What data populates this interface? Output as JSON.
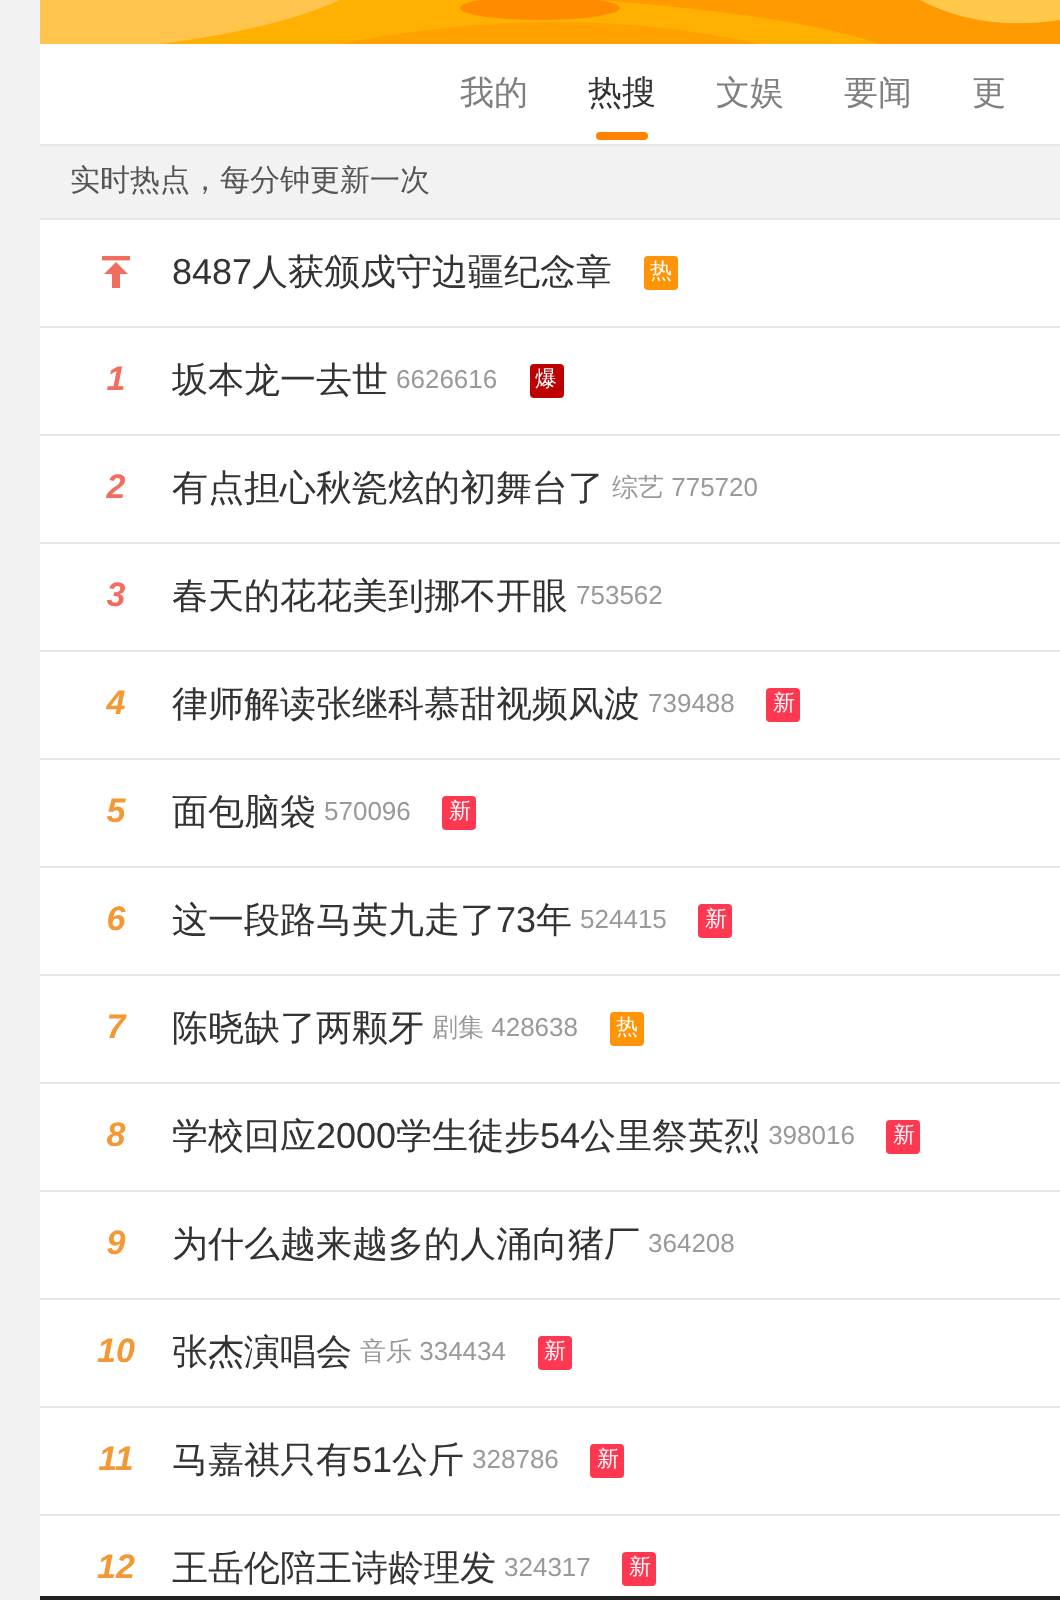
{
  "tabs": [
    {
      "label": "我的",
      "selected": false
    },
    {
      "label": "热搜",
      "selected": true
    },
    {
      "label": "文娱",
      "selected": false
    },
    {
      "label": "要闻",
      "selected": false
    },
    {
      "label": "更",
      "selected": false
    }
  ],
  "notice": "实时热点，每分钟更新一次",
  "items": [
    {
      "kind": "pinned",
      "title": "8487人获颁戍守边疆纪念章",
      "badge": {
        "kind": "hot",
        "text": "热"
      }
    },
    {
      "kind": "ranked",
      "rank": "1",
      "color": "#f26d5f",
      "title": "坂本龙一去世",
      "count": "6626616",
      "badge": {
        "kind": "boom",
        "text": "爆"
      }
    },
    {
      "kind": "ranked",
      "rank": "2",
      "color": "#f26d5f",
      "title": "有点担心秋瓷炫的初舞台了",
      "category": "综艺",
      "count": "775720"
    },
    {
      "kind": "ranked",
      "rank": "3",
      "color": "#f26d5f",
      "title": "春天的花花美到挪不开眼",
      "count": "753562"
    },
    {
      "kind": "ranked",
      "rank": "4",
      "color": "#f49836",
      "title": "律师解读张继科慕甜视频风波",
      "count": "739488",
      "badge": {
        "kind": "new",
        "text": "新"
      }
    },
    {
      "kind": "ranked",
      "rank": "5",
      "color": "#f49836",
      "title": "面包脑袋",
      "count": "570096",
      "badge": {
        "kind": "new",
        "text": "新"
      }
    },
    {
      "kind": "ranked",
      "rank": "6",
      "color": "#f49836",
      "title": "这一段路马英九走了73年",
      "count": "524415",
      "badge": {
        "kind": "new",
        "text": "新"
      }
    },
    {
      "kind": "ranked",
      "rank": "7",
      "color": "#f49836",
      "title": "陈晓缺了两颗牙",
      "category": "剧集",
      "count": "428638",
      "badge": {
        "kind": "hot",
        "text": "热"
      }
    },
    {
      "kind": "ranked",
      "rank": "8",
      "color": "#f49836",
      "title": "学校回应2000学生徒步54公里祭英烈",
      "count": "398016",
      "badge": {
        "kind": "new",
        "text": "新"
      }
    },
    {
      "kind": "ranked",
      "rank": "9",
      "color": "#f49836",
      "title": "为什么越来越多的人涌向猪厂",
      "count": "364208"
    },
    {
      "kind": "ranked",
      "rank": "10",
      "color": "#f49836",
      "title": "张杰演唱会",
      "category": "音乐",
      "count": "334434",
      "badge": {
        "kind": "new",
        "text": "新"
      }
    },
    {
      "kind": "ranked",
      "rank": "11",
      "color": "#f49836",
      "title": "马嘉祺只有51公斤",
      "count": "328786",
      "badge": {
        "kind": "new",
        "text": "新"
      }
    },
    {
      "kind": "ranked",
      "rank": "12",
      "color": "#f49836",
      "title": "王岳伦陪王诗龄理发",
      "count": "324317",
      "badge": {
        "kind": "new",
        "text": "新"
      }
    }
  ]
}
